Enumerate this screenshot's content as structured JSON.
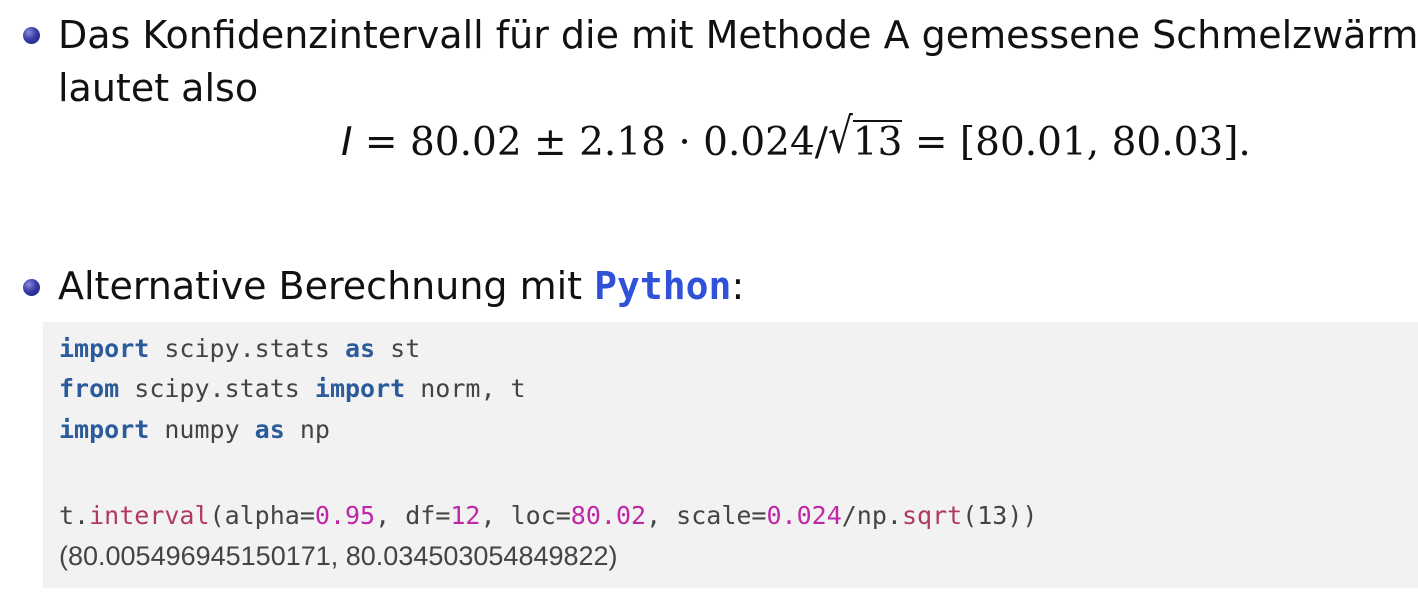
{
  "bullets": [
    {
      "line1": "Das Konfidenzintervall für die mit Methode A gemessene Schmelzwärme",
      "line2": "lautet also"
    },
    {
      "prefix": "Alternative Berechnung mit ",
      "highlight": "Python",
      "suffix": ":"
    }
  ],
  "formula": {
    "variable": "I",
    "expression": " = 80.02 ± 2.18 · 0.024/",
    "sqrt_symbol": "√",
    "sqrt_argument": "13",
    "result": " = [80.01, 80.03]."
  },
  "code": {
    "line1": [
      "import",
      " scipy.stats ",
      "as",
      " st"
    ],
    "line2": [
      "from",
      " scipy.stats ",
      "import",
      " norm, t"
    ],
    "line3": [
      "import",
      " numpy ",
      "as",
      " np"
    ],
    "line5": {
      "obj": "t.",
      "func": "interval",
      "p1": "(alpha=",
      "alpha": "0.95",
      "p2": ", df=",
      "df": "12",
      "p3": ", loc=",
      "loc": "80.02",
      "p4": ", scale=",
      "scale": "0.024",
      "p5": "/np.",
      "sqrt_fn": "sqrt",
      "p6": "(13))"
    },
    "output": "(80.005496945150171, 80.034503054849822)"
  },
  "colors": {
    "bullet": "#2e2e96",
    "python_highlight": "#2f52d8",
    "code_background": "#f2f2f2",
    "keyword": "#2b5b9a",
    "function": "#b03a5e",
    "number": "#c026a8"
  }
}
